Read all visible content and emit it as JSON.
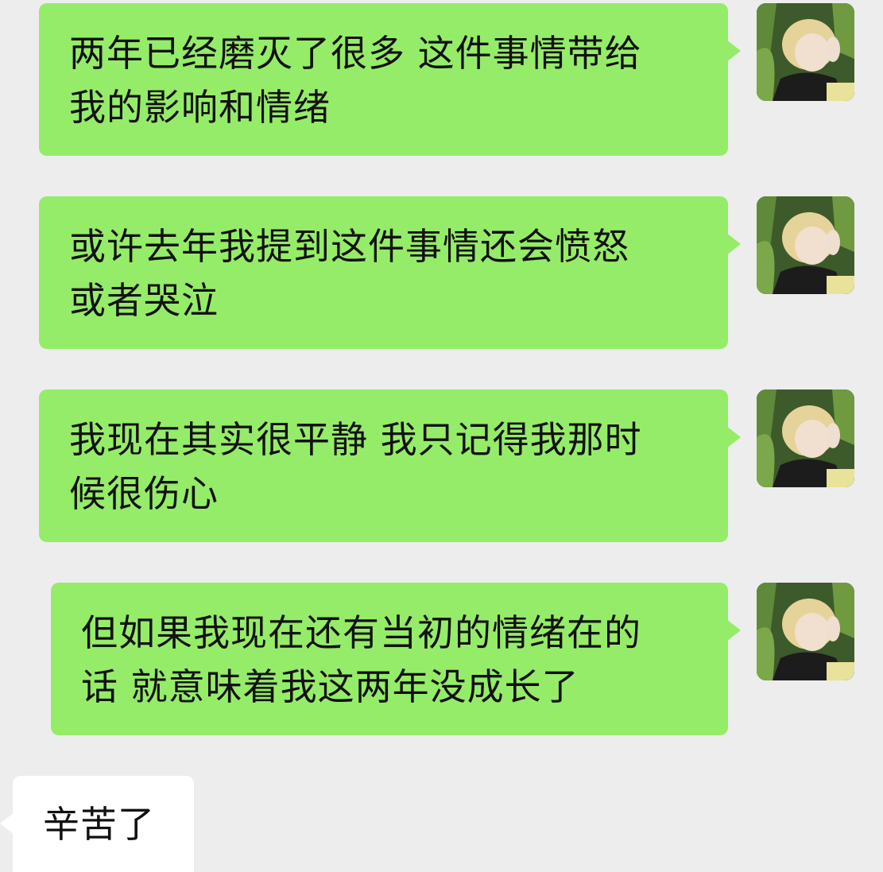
{
  "conversation": {
    "messages": [
      {
        "direction": "outgoing",
        "lines": [
          "两年已经磨灭了很多 这件事情带给",
          "我的影响和情绪"
        ]
      },
      {
        "direction": "outgoing",
        "lines": [
          "或许去年我提到这件事情还会愤怒",
          "或者哭泣"
        ]
      },
      {
        "direction": "outgoing",
        "lines": [
          "我现在其实很平静 我只记得我那时",
          "候很伤心"
        ]
      },
      {
        "direction": "outgoing",
        "lines": [
          "但如果我现在还有当初的情绪在的",
          "话 就意味着我这两年没成长了"
        ]
      },
      {
        "direction": "incoming",
        "lines": [
          "辛苦了"
        ]
      }
    ]
  },
  "theme": {
    "background": "#ededed",
    "outgoing_bubble": "#95ec69",
    "incoming_bubble": "#ffffff",
    "text": "#111111"
  },
  "avatar_icon": "user-avatar-photo"
}
